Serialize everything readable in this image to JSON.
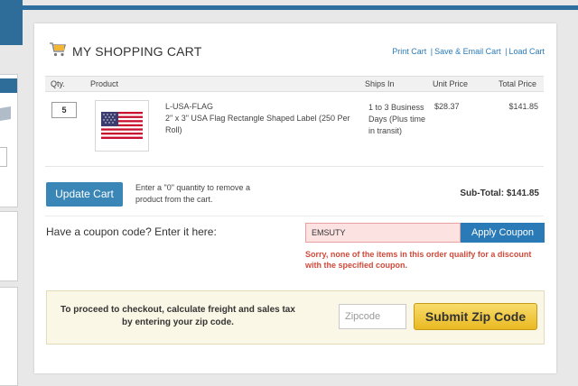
{
  "cart": {
    "title": "MY SHOPPING CART",
    "links": {
      "print": "Print Cart",
      "save_email": "Save & Email Cart",
      "load": "Load Cart",
      "separator": "|"
    },
    "table": {
      "headers": {
        "qty": "Qty.",
        "product": "Product",
        "ships_in": "Ships In",
        "unit_price": "Unit Price",
        "total_price": "Total Price"
      },
      "rows": [
        {
          "qty": "5",
          "sku": "L-USA-FLAG",
          "description": "2\" x 3\" USA Flag Rectangle Shaped Label (250 Per Roll)",
          "ships_in": "1 to 3 Business Days (Plus time in transit)",
          "unit_price": "$28.37",
          "total_price": "$141.85"
        }
      ]
    },
    "update_button": "Update Cart",
    "update_hint": "Enter a \"0\" quantity to remove a product from the cart.",
    "subtotal": "Sub-Total:  $141.85"
  },
  "coupon": {
    "label": "Have a coupon code? Enter it here:",
    "value": "EMSUTY",
    "apply_button": "Apply Coupon",
    "error": "Sorry, none of the items in this order qualify for a discount with the specified coupon."
  },
  "zip": {
    "text": "To proceed to checkout, calculate freight and sales tax by entering your zip code.",
    "placeholder": "Zipcode",
    "submit_button": "Submit Zip Code"
  },
  "colors": {
    "accent": "#2a7ab8",
    "update_button": "#3a86b6",
    "error": "#d04a3a",
    "zip_button": "#e9b922"
  }
}
